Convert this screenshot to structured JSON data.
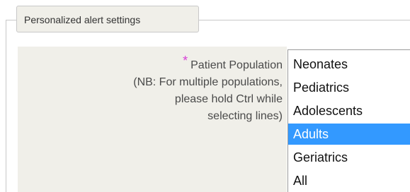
{
  "fieldset": {
    "legend": "Personalized alert settings"
  },
  "patient_population": {
    "required_mark": "*",
    "label": "Patient Population",
    "note_line1": "(NB: For multiple populations,",
    "note_line2": "please hold Ctrl while",
    "note_line3": "selecting lines)",
    "options": [
      "Neonates",
      "Pediatrics",
      "Adolescents",
      "Adults",
      "Geriatrics",
      "All"
    ],
    "selected": "Adults"
  },
  "colors": {
    "required_mark": "#d63ed6",
    "selection": "#3399ff",
    "label_panel": "#f0efe9"
  }
}
